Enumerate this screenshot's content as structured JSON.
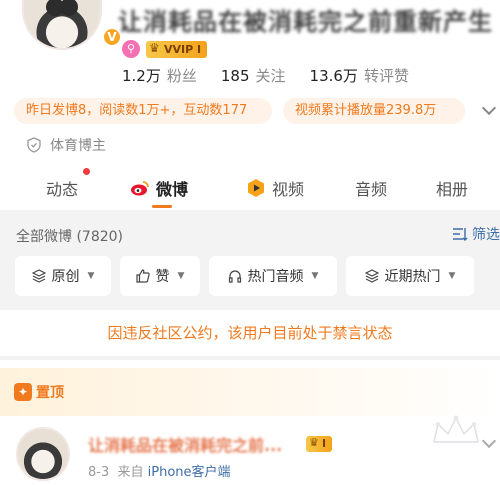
{
  "profile": {
    "name": "让消耗品在被消耗完之前重新产生",
    "verified_badge": "V",
    "vip_label": "VVIP I",
    "stats": [
      {
        "num": "1.2万",
        "label": "粉丝"
      },
      {
        "num": "185",
        "label": "关注"
      },
      {
        "num": "13.6万",
        "label": "转评赞"
      }
    ],
    "pill_yesterday": "昨日发博8，阅读数1万+，互动数177",
    "pill_video": "视频累计播放量239.8万",
    "role": "体育博主"
  },
  "tabs": [
    {
      "label": "动态"
    },
    {
      "label": "微博"
    },
    {
      "label": "视频"
    },
    {
      "label": "音频"
    },
    {
      "label": "相册"
    }
  ],
  "feed": {
    "title": "全部微博 (7820)",
    "filter_label": "筛选",
    "chips": [
      {
        "label": "原创",
        "icon": "layers-icon"
      },
      {
        "label": "赞",
        "icon": "thumbs-up-icon"
      },
      {
        "label": "热门音频",
        "icon": "headphones-icon"
      },
      {
        "label": "近期热门",
        "icon": "layers-icon"
      }
    ],
    "ban_notice": "因违反社区公约，该用户目前处于禁言状态"
  },
  "pinned": {
    "label": "置顶",
    "author": "让消耗品在被消耗完之前...",
    "crown_label": "I",
    "date": "8-3",
    "source_prefix": "来自",
    "source": "iPhone客户端"
  },
  "colors": {
    "accent": "#f07a1e",
    "link": "#3d6ea7",
    "vip_gold": "#f3a21a"
  }
}
